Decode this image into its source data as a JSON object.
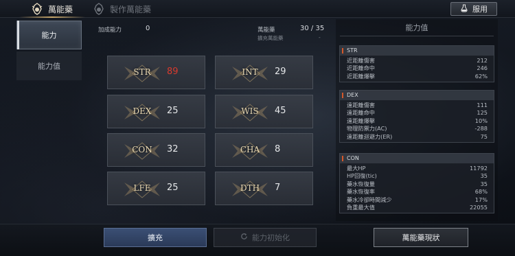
{
  "topbar": {
    "tabs": [
      {
        "label": "萬能藥",
        "icon": "potion-emblem-icon",
        "active": true
      },
      {
        "label": "製作萬能藥",
        "icon": "craft-emblem-icon",
        "active": false
      }
    ],
    "use_button": {
      "label": "服用",
      "icon": "potion-flask-icon"
    }
  },
  "sidebar": {
    "items": [
      {
        "label": "能力",
        "active": true
      },
      {
        "label": "能力值",
        "active": false
      }
    ]
  },
  "summary": {
    "bonus_label": "加成能力",
    "bonus_value": "0",
    "elixir_label": "萬能藥",
    "elixir_value": "30 / 35",
    "expand_label": "擴充萬能藥",
    "expand_value": "-"
  },
  "stats": [
    {
      "name": "STR",
      "value": "89",
      "highlight": true
    },
    {
      "name": "INT",
      "value": "29",
      "highlight": false
    },
    {
      "name": "DEX",
      "value": "25",
      "highlight": false
    },
    {
      "name": "WIS",
      "value": "45",
      "highlight": false
    },
    {
      "name": "CON",
      "value": "32",
      "highlight": false
    },
    {
      "name": "CHA",
      "value": "8",
      "highlight": false
    },
    {
      "name": "LFE",
      "value": "25",
      "highlight": false
    },
    {
      "name": "DTH",
      "value": "7",
      "highlight": false
    }
  ],
  "panel": {
    "title": "能力值",
    "groups": [
      {
        "name": "STR",
        "rows": [
          {
            "label": "近距離傷害",
            "value": "212"
          },
          {
            "label": "近距離命中",
            "value": "246"
          },
          {
            "label": "近距離爆擊",
            "value": "62%"
          }
        ]
      },
      {
        "name": "DEX",
        "rows": [
          {
            "label": "遠距離傷害",
            "value": "111"
          },
          {
            "label": "遠距離命中",
            "value": "125"
          },
          {
            "label": "遠距離爆擊",
            "value": "10%"
          },
          {
            "label": "物理防禦力(AC)",
            "value": "-288"
          },
          {
            "label": "遠距離迴避力(ER)",
            "value": "75"
          }
        ]
      },
      {
        "name": "CON",
        "rows": [
          {
            "label": "最大HP",
            "value": "11792"
          },
          {
            "label": "HP回復(tic)",
            "value": "35"
          },
          {
            "label": "藥水恢復量",
            "value": "35"
          },
          {
            "label": "藥水恢復率",
            "value": "68%"
          },
          {
            "label": "藥水冷卻時間減少",
            "value": "17%"
          },
          {
            "label": "負重最大值",
            "value": "22055"
          }
        ]
      }
    ]
  },
  "bottom": {
    "expand_label": "擴充",
    "reset_label": "能力初始化",
    "status_label": "萬能藥現狀"
  },
  "colors": {
    "accent_gold": "#c9a86a",
    "highlight_red": "#d83a2e",
    "expand_button_blue": "#2a3a58"
  }
}
